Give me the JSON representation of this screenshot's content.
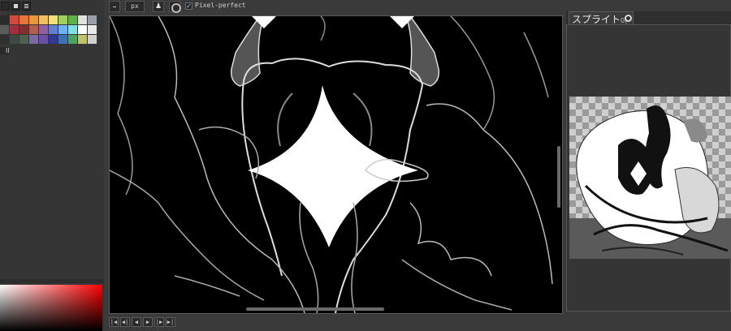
{
  "toolbar": {
    "unit_label": "px",
    "pixel_perfect_label": "Pixel-perfect",
    "pixel_perfect_checked": true,
    "icons": [
      "dash-icon",
      "pen-icon",
      "ring-icon"
    ]
  },
  "palette": {
    "colors": [
      "#2b2b2b",
      "#d04a3c",
      "#e8763a",
      "#e89a3a",
      "#f0c060",
      "#f0e080",
      "#a0d060",
      "#60b050",
      "#e0e0e0",
      "#9aa0a8",
      "#5a5a5a",
      "#a03040",
      "#803030",
      "#b06050",
      "#9060a0",
      "#6080d0",
      "#70b0f0",
      "#80e0e0",
      "#ffffff",
      "#e8e8e8",
      "#303030",
      "#404a40",
      "#506050",
      "#7a6aa0",
      "#6a50a0",
      "#303890",
      "#4070b0",
      "#50a060",
      "#c0c070",
      "#d0d0d0"
    ],
    "small_label": "II"
  },
  "sprite_panel": {
    "tab_label": "スプライト",
    "tab_suffix": "0("
  },
  "animation_controls": {
    "buttons": [
      "|◀",
      "◀|",
      "◀",
      "▶",
      "|▶",
      "▶|"
    ]
  },
  "colors": {
    "app_bg": "#3a3a3a",
    "canvas_bg": "#000000",
    "accent_check": "#8ec5ff"
  }
}
